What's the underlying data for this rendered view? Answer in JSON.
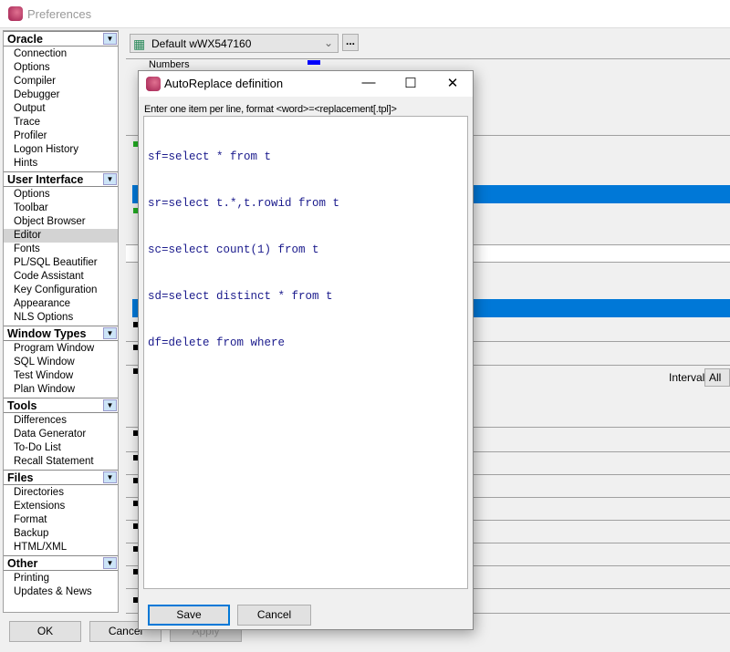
{
  "window": {
    "title": "Preferences"
  },
  "sidebar": {
    "sections": [
      {
        "label": "Oracle",
        "items": [
          "Connection",
          "Options",
          "Compiler",
          "Debugger",
          "Output",
          "Trace",
          "Profiler",
          "Logon History",
          "Hints"
        ]
      },
      {
        "label": "User Interface",
        "items": [
          "Options",
          "Toolbar",
          "Object Browser",
          "Editor",
          "Fonts",
          "PL/SQL Beautifier",
          "Code Assistant",
          "Key Configuration",
          "Appearance",
          "NLS Options"
        ]
      },
      {
        "label": "Window Types",
        "items": [
          "Program Window",
          "SQL Window",
          "Test Window",
          "Plan Window"
        ]
      },
      {
        "label": "Tools",
        "items": [
          "Differences",
          "Data Generator",
          "To-Do List",
          "Recall Statement"
        ]
      },
      {
        "label": "Files",
        "items": [
          "Directories",
          "Extensions",
          "Format",
          "Backup",
          "HTML/XML"
        ]
      },
      {
        "label": "Other",
        "items": [
          "Printing",
          "Updates & News"
        ]
      }
    ],
    "selected": "Editor"
  },
  "profile": {
    "value": "Default wWX547160",
    "more": "..."
  },
  "background": {
    "numbers_label": "Numbers",
    "interval_label": "Interval",
    "interval_value": "All"
  },
  "footer": {
    "ok": "OK",
    "cancel": "Cancel",
    "apply": "Apply"
  },
  "dialog": {
    "title": "AutoReplace definition",
    "hint": "Enter one item per line, format <word>=<replacement[.tpl]>",
    "lines": [
      "sf=select * from t",
      "sr=select t.*,t.rowid from t",
      "sc=select count(1) from t",
      "sd=select distinct * from t",
      "df=delete from where"
    ],
    "save": "Save",
    "cancel": "Cancel"
  },
  "colors": {
    "selection": "#0078d7",
    "code_text": "#1a1a8c"
  }
}
